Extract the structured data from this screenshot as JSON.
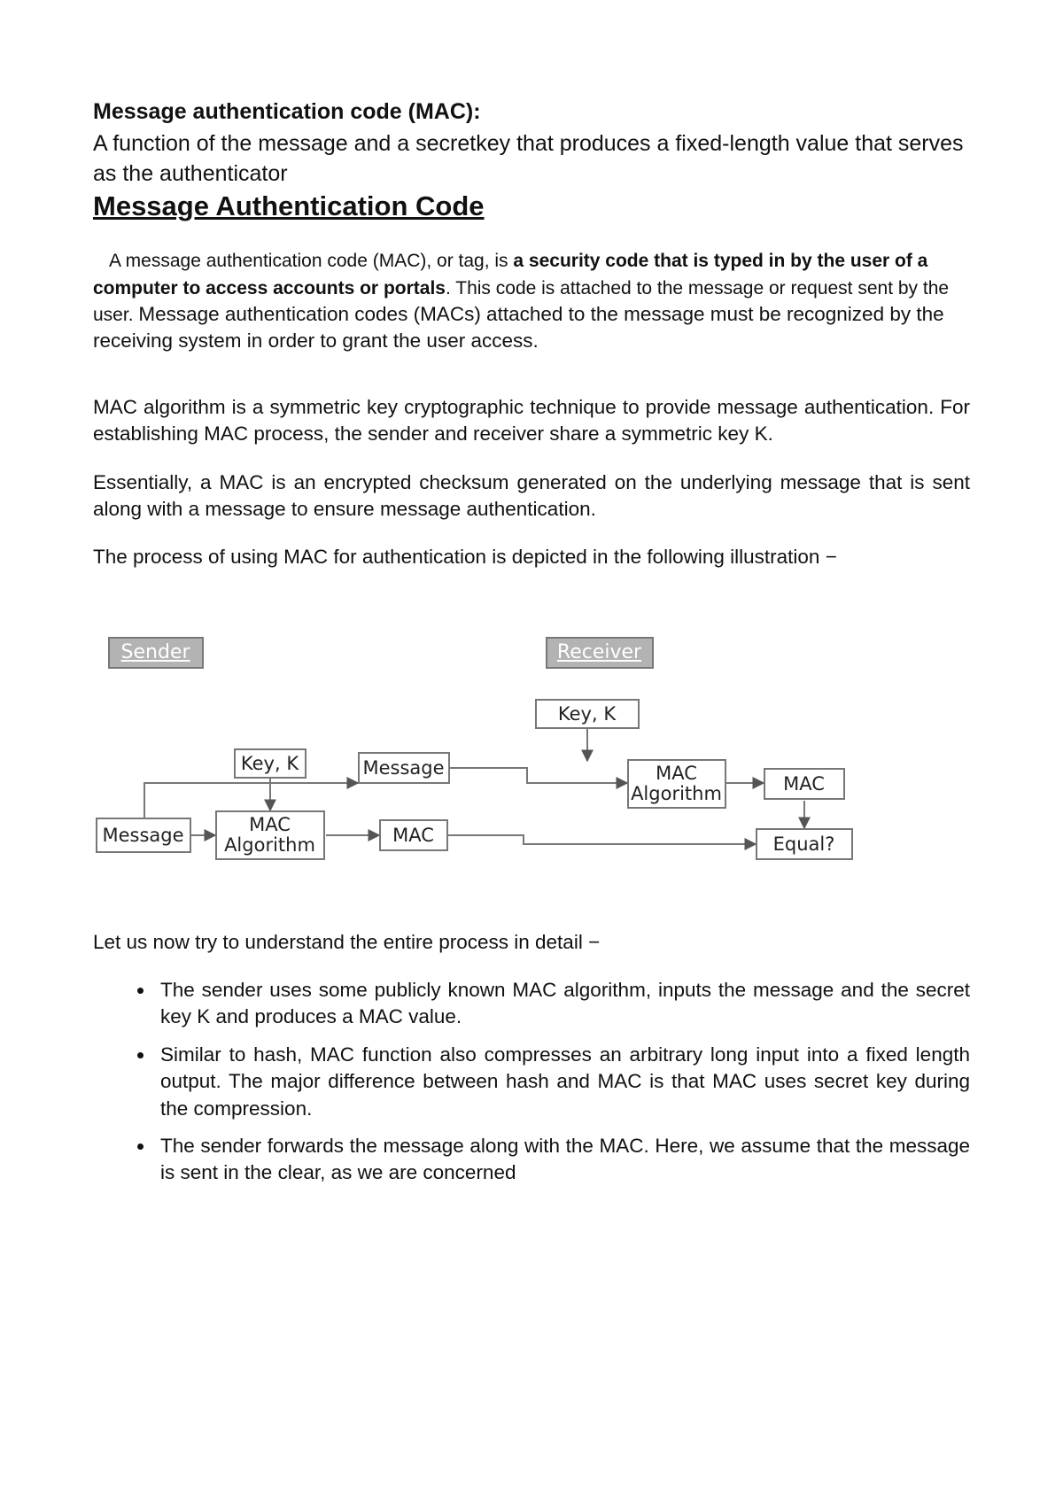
{
  "doc": {
    "heading_bold": "Message authentication code (MAC):",
    "intro_line": "A function of the message and a secretkey that produces a fixed-length value that serves as the authenticator",
    "section_title": "Message Authentication Code",
    "p1_prefix": "A message authentication code (MAC), or tag, is ",
    "p1_bold": "a security code that is typed in by the user of a computer to access accounts or portals",
    "p1_small": ". This code is attached to the message or request sent by the user. ",
    "p1_tail": "Message authentication codes (MACs) attached to the message must be recognized by the receiving system in order to grant the user access.",
    "p2": "MAC algorithm is a symmetric key cryptographic technique to provide message authentication. For establishing MAC process, the sender and receiver share a symmetric key K.",
    "p3": "Essentially, a MAC is an encrypted checksum generated on the underlying message that is sent along with a message to ensure message authentication.",
    "p4": "The process of using MAC for authentication is depicted in the following illustration −",
    "after_diag": "Let us now try to understand the entire process in detail −",
    "bullets": [
      "The sender uses some publicly known MAC algorithm, inputs the message and the secret key K and produces a MAC value.",
      "Similar to hash, MAC function also compresses an arbitrary long input into a fixed length output. The major difference between hash and MAC is that MAC uses secret key during the compression.",
      "The sender forwards the message along with the MAC. Here, we assume that the message is sent in the clear, as we are concerned"
    ]
  },
  "diagram": {
    "sender": "Sender",
    "receiver": "Receiver",
    "key": "Key, K",
    "mac_alg_l1": "MAC",
    "mac_alg_l2": "Algorithm",
    "message": "Message",
    "mac": "MAC",
    "equal": "Equal?"
  }
}
